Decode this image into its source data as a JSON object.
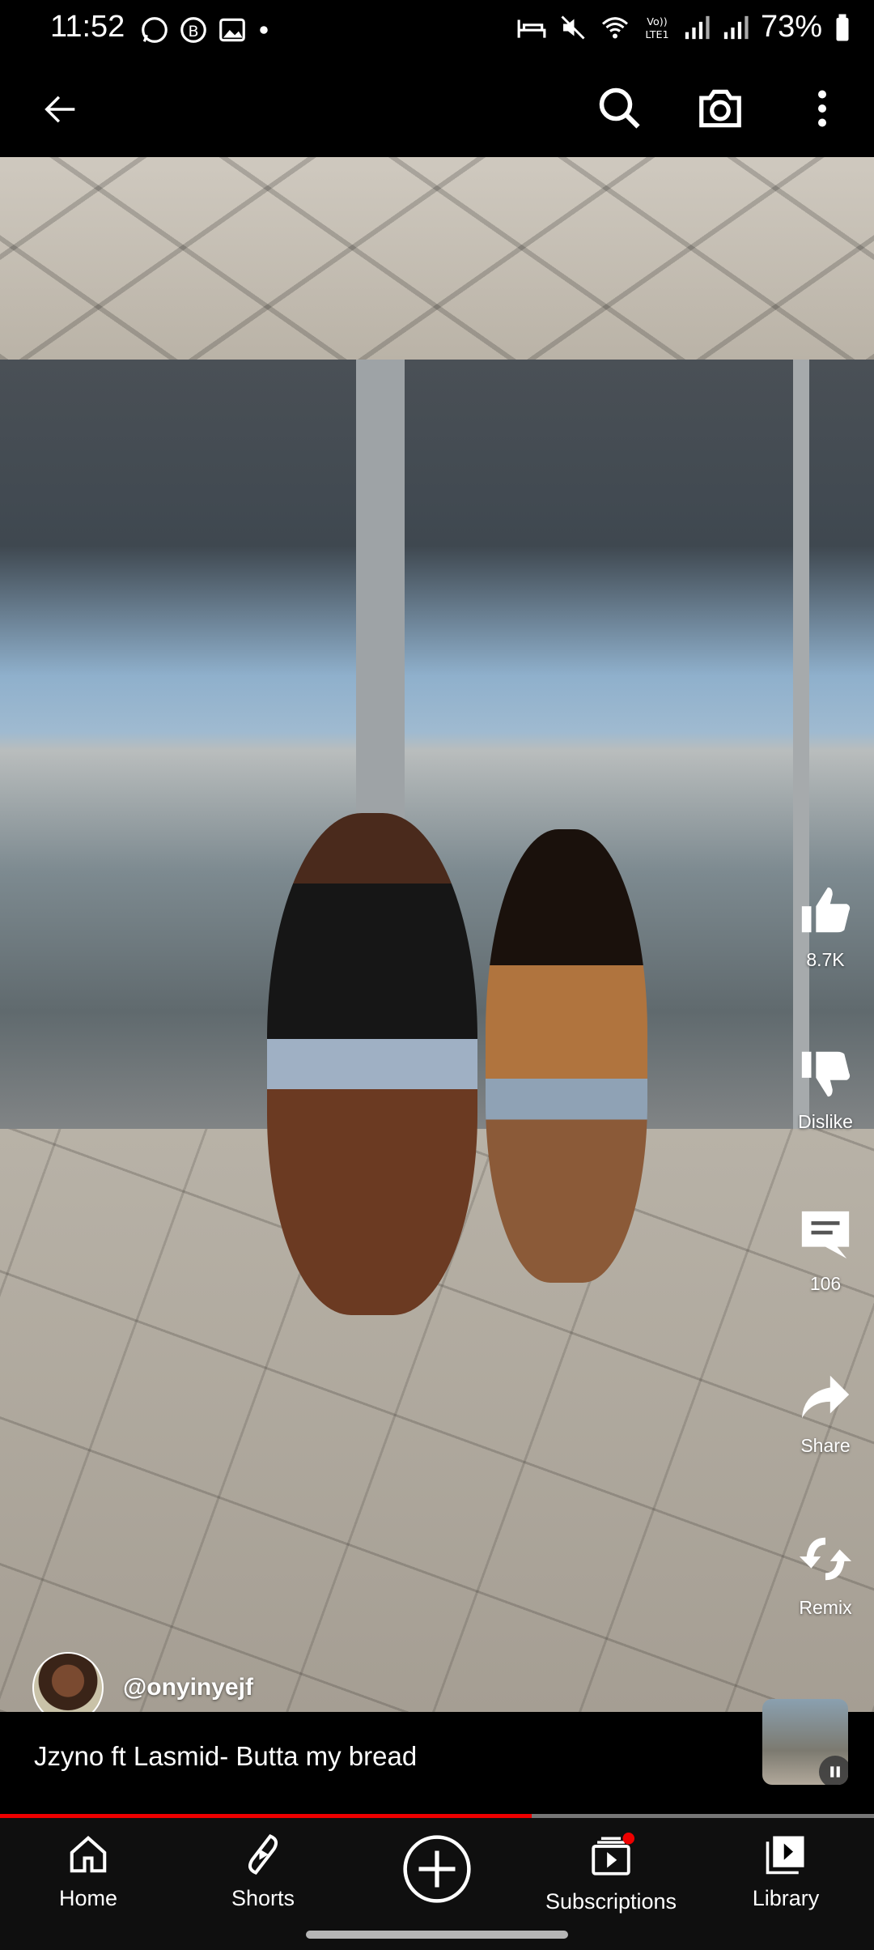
{
  "status_bar": {
    "time": "11:52",
    "battery": "73%",
    "network_label": "Vo))\nLTE1"
  },
  "top_bar": {
    "back": "back-arrow-icon",
    "search": "search-icon",
    "camera": "camera-icon",
    "more": "more-vertical-icon"
  },
  "actions": {
    "like": {
      "label": "8.7K",
      "icon": "thumbs-up-icon"
    },
    "dislike": {
      "label": "Dislike",
      "icon": "thumbs-down-icon"
    },
    "comments": {
      "label": "106",
      "icon": "comment-icon"
    },
    "share": {
      "label": "Share",
      "icon": "share-icon"
    },
    "remix": {
      "label": "Remix",
      "icon": "remix-icon"
    }
  },
  "channel": {
    "handle": "@onyinyejf"
  },
  "music": {
    "title": "Jzyno ft Lasmid- Butta my bread"
  },
  "progress": {
    "fraction": 0.608,
    "fill_color": "#ee0000"
  },
  "bottom_nav": {
    "items": [
      {
        "label": "Home",
        "icon": "home-icon"
      },
      {
        "label": "Shorts",
        "icon": "shorts-icon"
      },
      {
        "label": "",
        "icon": "create-plus-icon"
      },
      {
        "label": "Subscriptions",
        "icon": "subscriptions-icon"
      },
      {
        "label": "Library",
        "icon": "library-icon"
      }
    ]
  }
}
